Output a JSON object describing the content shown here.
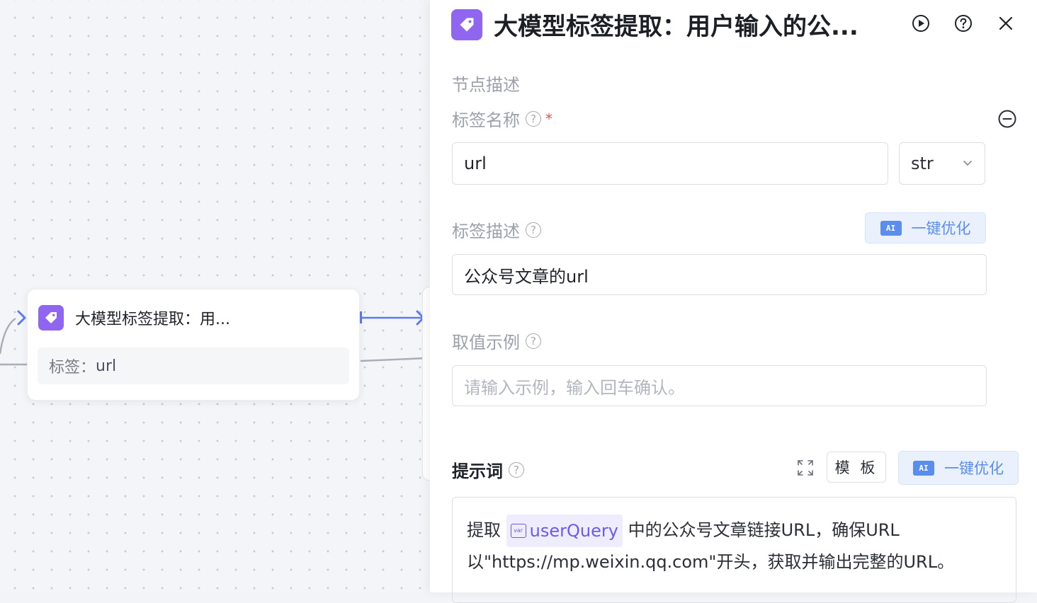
{
  "canvas": {
    "node": {
      "title": "大模型标签提取：用...",
      "tag_label": "标签：",
      "tag_value": "url"
    }
  },
  "panel": {
    "title": "大模型标签提取：用户输入的公...",
    "section_desc": "节点描述",
    "tag_name": {
      "label": "标签名称",
      "value": "url",
      "type_select": "str"
    },
    "tag_desc": {
      "label": "标签描述",
      "value": "公众号文章的url",
      "ai_button": "一键优化"
    },
    "example": {
      "label": "取值示例",
      "placeholder": "请输入示例，输入回车确认。"
    },
    "prompt": {
      "label": "提示词",
      "template_button": "模 板",
      "ai_button": "一键优化",
      "text_before": "提取",
      "variable": "userQuery",
      "text_after": "中的公众号文章链接URL，确保URL",
      "text_line2": "以\"https://mp.weixin.qq.com\"开头，获取并输出完整的URL。"
    },
    "ai_chip": "AI"
  },
  "colors": {
    "accent_purple": "#9066f0",
    "ai_blue": "#5b8def",
    "edge_blue": "#5b7cf0"
  },
  "icons": [
    "tag-icon",
    "run-icon",
    "help-icon",
    "close-icon",
    "remove-icon",
    "chevron-down-icon",
    "expand-icon",
    "variable-icon",
    "port-arrow-icon"
  ]
}
